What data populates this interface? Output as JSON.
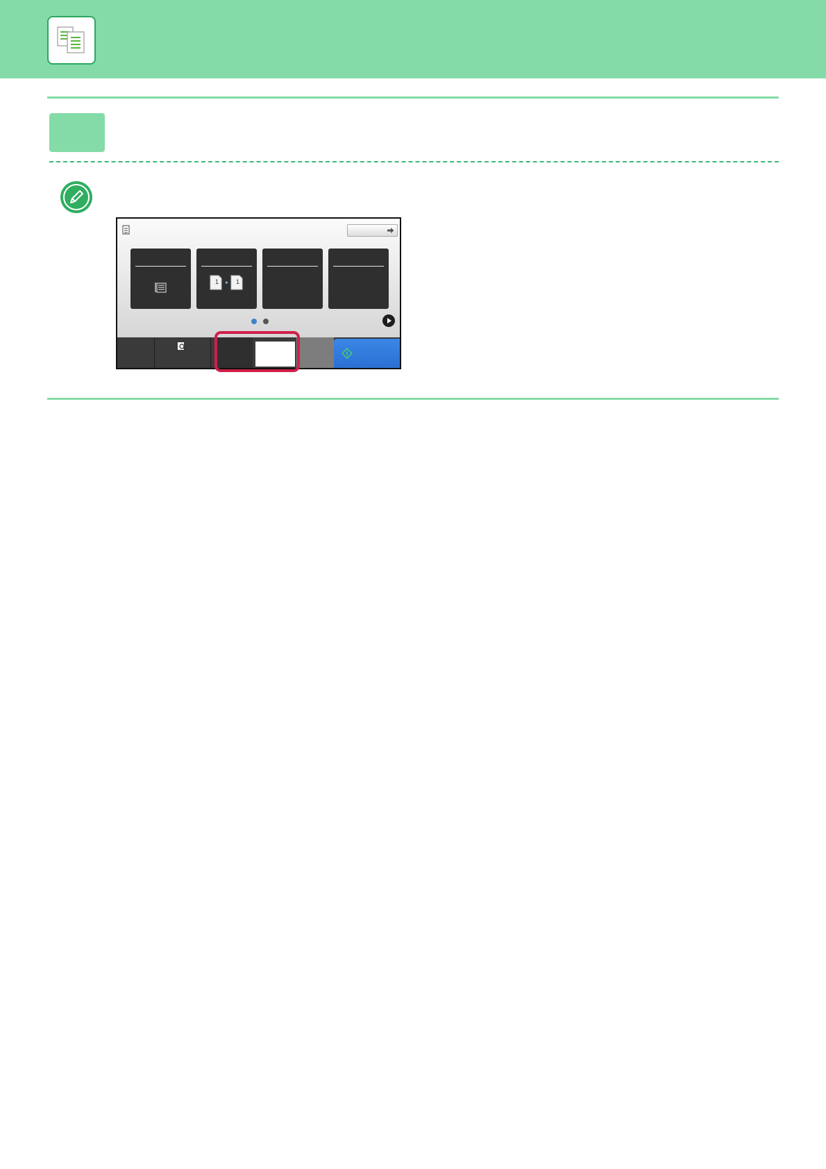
{
  "header": {
    "icon": "copy-mode-icon"
  },
  "section": {
    "step_box": "step-number-box"
  },
  "note": {
    "icon": "pencil-note-icon"
  },
  "panel": {
    "mode_icon": "copy-mode-icon",
    "top_right_button": "arrow-right-icon",
    "tiles": [
      {
        "icon": "original-document-icon"
      },
      {
        "icon": "one-to-one-sided-icon"
      },
      {
        "icon": ""
      },
      {
        "icon": ""
      }
    ],
    "pager": {
      "pages": 2,
      "current": 1
    },
    "next_icon": "play-arrow-icon",
    "bottom": {
      "preview_icon": "preview-magnifier-icon",
      "highlighted_control": "copies-field",
      "start_icon": "start-diamond-icon"
    },
    "colors": {
      "accent": "#84dba7",
      "highlight": "#d01f49",
      "start": "#2f78dc",
      "active_dot": "#3f82c9",
      "inactive_dot": "#555555"
    }
  }
}
